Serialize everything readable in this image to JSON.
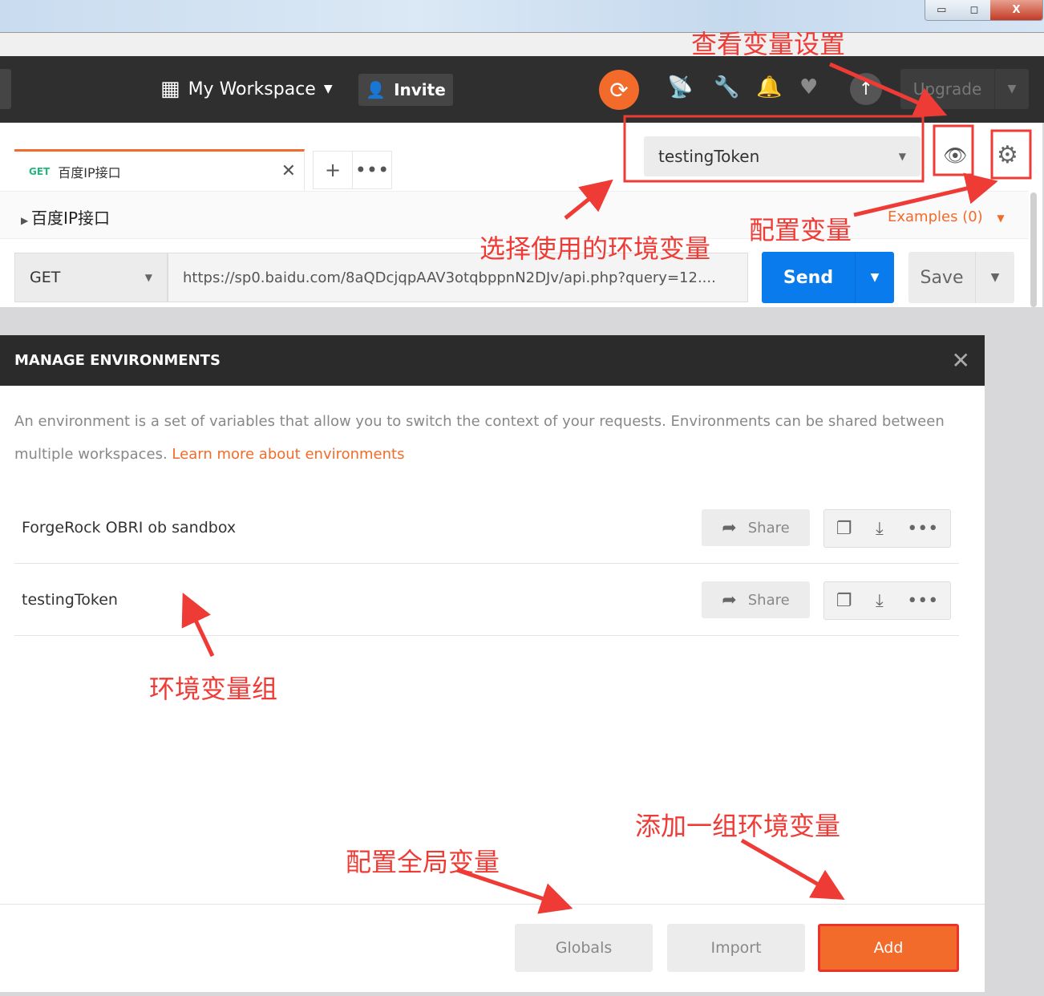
{
  "window": {
    "controls": [
      "▭",
      "◻",
      "X"
    ]
  },
  "header": {
    "workspace": "My Workspace",
    "invite": "Invite",
    "upgrade": "Upgrade"
  },
  "tab": {
    "method": "GET",
    "name": "百度IP接口"
  },
  "environment": {
    "selected": "testingToken"
  },
  "request": {
    "name": "百度IP接口",
    "examples": "Examples (0)",
    "method": "GET",
    "url": "https://sp0.baidu.com/8aQDcjqpAAV3otqbppnN2DJv/api.php?query=12....",
    "send": "Send",
    "save": "Save"
  },
  "modal": {
    "title": "MANAGE ENVIRONMENTS",
    "description": "An environment is a set of variables that allow you to switch the context of your requests. Environments can be shared between multiple workspaces. ",
    "learn_more": "Learn more about environments",
    "environments": [
      {
        "name": "ForgeRock OBRI ob sandbox",
        "share": "Share"
      },
      {
        "name": "testingToken",
        "share": "Share"
      }
    ],
    "buttons": {
      "globals": "Globals",
      "import": "Import",
      "add": "Add"
    }
  },
  "annotations": {
    "view_vars": "查看变量设置",
    "select_env": "选择使用的环境变量",
    "config_vars": "配置变量",
    "env_group": "环境变量组",
    "config_globals": "配置全局变量",
    "add_group": "添加一组环境变量"
  },
  "colors": {
    "accent": "#f26b2a",
    "send": "#097bed",
    "annotation": "#ee3b36",
    "header": "#2f2f2f"
  }
}
